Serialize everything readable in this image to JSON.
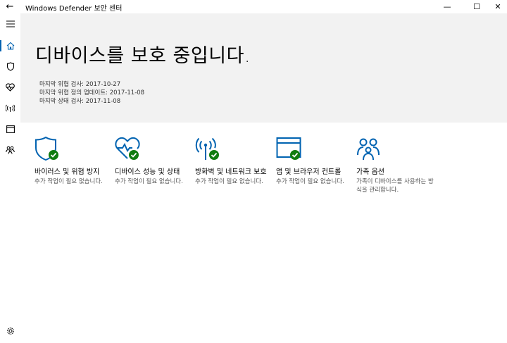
{
  "window": {
    "title": "Windows Defender 보안 센터",
    "back_glyph": "←",
    "minimize_glyph": "—",
    "maximize_glyph": "☐",
    "close_glyph": "✕"
  },
  "sidebar": {
    "items": [
      {
        "icon": "hamburger-menu-icon"
      },
      {
        "icon": "home-icon",
        "active": true
      },
      {
        "icon": "shield-icon"
      },
      {
        "icon": "heart-icon"
      },
      {
        "icon": "wifi-antenna-icon"
      },
      {
        "icon": "browser-window-icon"
      },
      {
        "icon": "family-icon"
      }
    ],
    "settings_icon": "gear-icon"
  },
  "hero": {
    "title": "디바이스를 보호 중입니다.",
    "lines": [
      "마지막 위협 검사: 2017-10-27",
      "마지막 위협 정의 업데이트: 2017-11-08",
      "마지막 상태 검사: 2017-11-08"
    ]
  },
  "tiles": [
    {
      "title": "바이러스 및 위협 방지",
      "desc": "추가 작업이 필요 없습니다.",
      "icon": "shield-check-icon"
    },
    {
      "title": "디바이스 성능 및 상태",
      "desc": "추가 작업이 필요 없습니다.",
      "icon": "heart-check-icon"
    },
    {
      "title": "방화벽 및 네트워크 보호",
      "desc": "추가 작업이 필요 없습니다.",
      "icon": "antenna-check-icon"
    },
    {
      "title": "앱 및 브라우저 컨트롤",
      "desc": "추가 작업이 필요 없습니다.",
      "icon": "browser-check-icon"
    },
    {
      "title": "가족 옵션",
      "desc": "가족이 디바이스를 사용하는 방식을 관리합니다.",
      "icon": "family-icon"
    }
  ],
  "colors": {
    "accent": "#0063b1",
    "check_green": "#107c10",
    "hero_bg": "#f2f2f2"
  }
}
